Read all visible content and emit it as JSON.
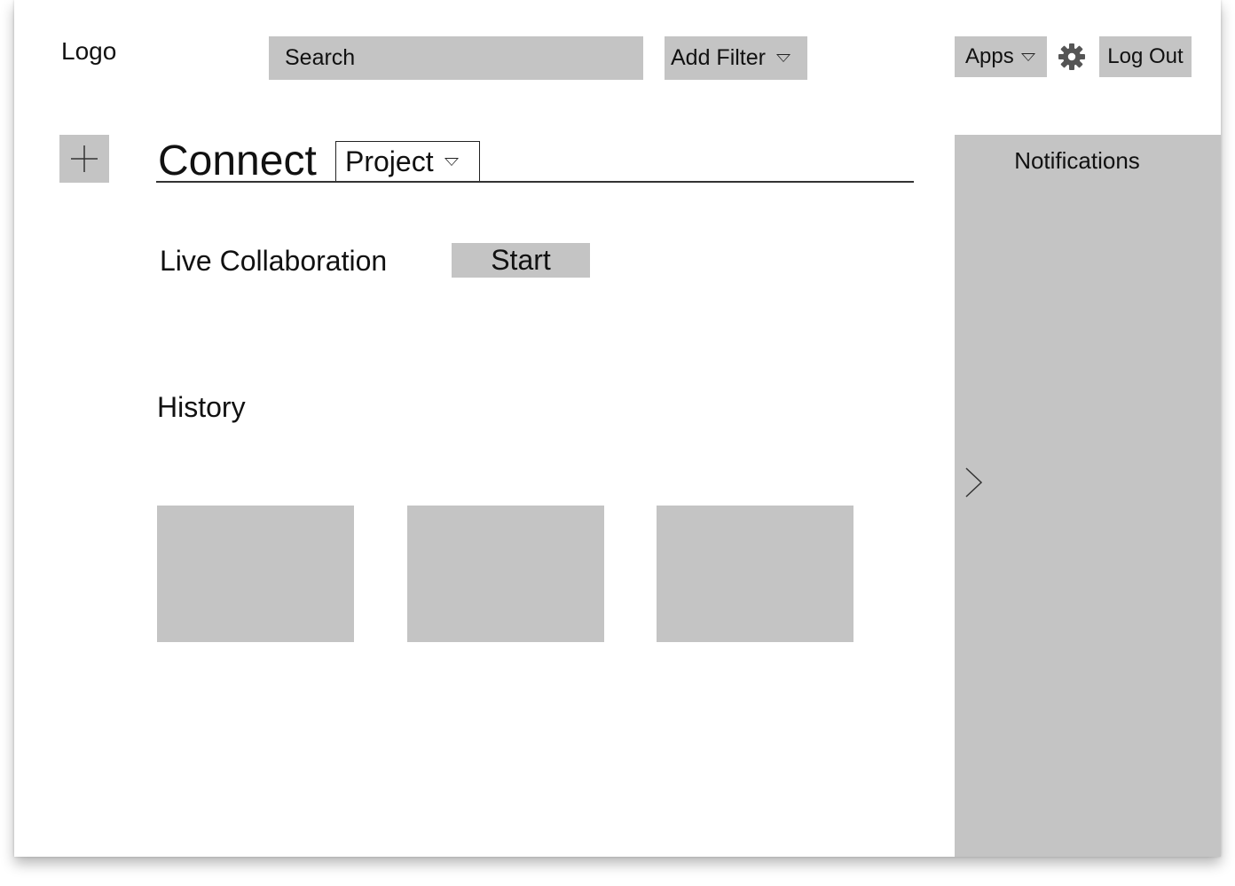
{
  "header": {
    "logo": "Logo",
    "search": {
      "placeholder": "Search"
    },
    "add_filter_label": "Add Filter",
    "apps_label": "Apps",
    "logout_label": "Log Out"
  },
  "main": {
    "title": "Connect",
    "project_select": "Project",
    "live_collaboration": {
      "label": "Live Collaboration",
      "button": "Start"
    },
    "history": {
      "label": "History",
      "cards": [
        "",
        "",
        ""
      ]
    }
  },
  "notifications": {
    "title": "Notifications"
  },
  "colors": {
    "placeholder_gray": "#c4c4c4",
    "text": "#111111"
  }
}
